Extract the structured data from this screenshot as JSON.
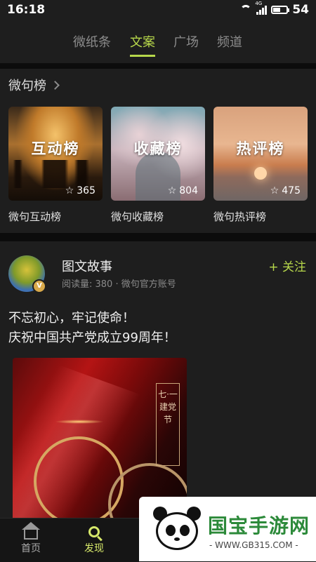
{
  "status_bar": {
    "time": "16:18",
    "network_tag": "4G",
    "battery_level": 54,
    "battery_label": "54"
  },
  "tabs": [
    {
      "label": "微纸条",
      "active": false
    },
    {
      "label": "文案",
      "active": true
    },
    {
      "label": "广场",
      "active": false
    },
    {
      "label": "频道",
      "active": false
    }
  ],
  "ranking": {
    "title": "微句榜",
    "cards": [
      {
        "art_text": "互动榜",
        "count": "365",
        "caption": "微句互动榜"
      },
      {
        "art_text": "收藏榜",
        "count": "804",
        "caption": "微句收藏榜"
      },
      {
        "art_text": "热评榜",
        "count": "475",
        "caption": "微句热评榜"
      }
    ]
  },
  "post": {
    "author": "图文故事",
    "meta": "阅读量: 380 · 微句官方账号",
    "follow_label": "+ 关注",
    "verified_badge": "V",
    "text_lines": [
      "不忘初心，牢记使命！",
      "庆祝中国共产党成立99周年！"
    ],
    "image_label": "七·一 建党节"
  },
  "bottom_nav": [
    {
      "label": "首页",
      "icon": "home-icon",
      "active": false
    },
    {
      "label": "发现",
      "icon": "search-icon",
      "active": true
    }
  ],
  "watermark": {
    "brand": "国宝手游网",
    "url": "- WWW.GB315.COM -"
  },
  "colors": {
    "accent": "#b7d84b",
    "background": "#1e1e1e",
    "band": "#0c0c0c"
  }
}
